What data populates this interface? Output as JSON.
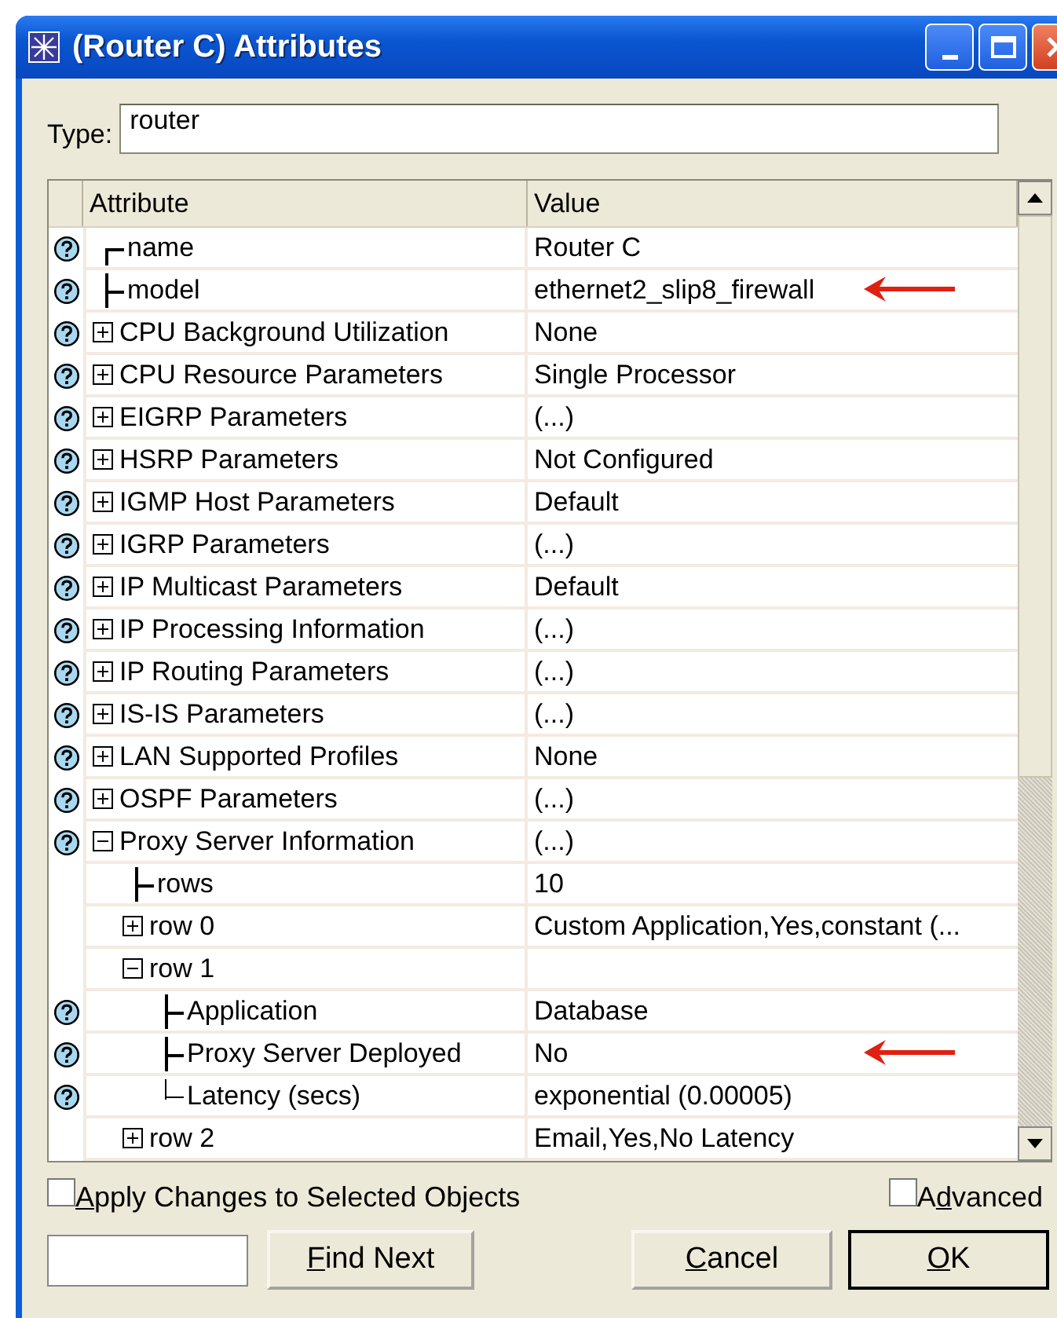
{
  "window": {
    "title": "(Router C) Attributes"
  },
  "type_field": {
    "label": "Type:",
    "value": "router"
  },
  "table": {
    "columns": [
      "Attribute",
      "Value"
    ],
    "rows": [
      {
        "name": "name",
        "value": "Router C",
        "help": true,
        "arrow": false
      },
      {
        "name": "model",
        "value": "ethernet2_slip8_firewall",
        "help": true,
        "arrow": true
      },
      {
        "name": "CPU Background Utilization",
        "value": "None",
        "help": true,
        "arrow": false,
        "expanded": false
      },
      {
        "name": "CPU Resource Parameters",
        "value": "Single Processor",
        "help": true,
        "arrow": false,
        "expanded": false
      },
      {
        "name": "EIGRP Parameters",
        "value": "(...)",
        "help": true,
        "arrow": false,
        "expanded": false
      },
      {
        "name": "HSRP Parameters",
        "value": "Not Configured",
        "help": true,
        "arrow": false,
        "expanded": false
      },
      {
        "name": "IGMP Host Parameters",
        "value": "Default",
        "help": true,
        "arrow": false,
        "expanded": false
      },
      {
        "name": "IGRP Parameters",
        "value": "(...)",
        "help": true,
        "arrow": false,
        "expanded": false
      },
      {
        "name": "IP Multicast Parameters",
        "value": "Default",
        "help": true,
        "arrow": false,
        "expanded": false
      },
      {
        "name": "IP Processing Information",
        "value": "(...)",
        "help": true,
        "arrow": false,
        "expanded": false
      },
      {
        "name": "IP Routing Parameters",
        "value": "(...)",
        "help": true,
        "arrow": false,
        "expanded": false
      },
      {
        "name": "IS-IS Parameters",
        "value": "(...)",
        "help": true,
        "arrow": false,
        "expanded": false
      },
      {
        "name": "LAN Supported Profiles",
        "value": "None",
        "help": true,
        "arrow": false,
        "expanded": false
      },
      {
        "name": "OSPF Parameters",
        "value": "(...)",
        "help": true,
        "arrow": false,
        "expanded": false
      },
      {
        "name": "Proxy Server Information",
        "value": "(...)",
        "help": true,
        "arrow": false,
        "expanded": true,
        "children": [
          {
            "name": "rows",
            "value": "10",
            "help": false,
            "arrow": false
          },
          {
            "name": "row 0",
            "value": "Custom Application,Yes,constant (...",
            "help": false,
            "arrow": false,
            "expanded": false
          },
          {
            "name": "row 1",
            "help": false,
            "arrow": false,
            "expanded": true,
            "children": [
              {
                "name": "Application",
                "value": "Database",
                "help": true,
                "arrow": false
              },
              {
                "name": "Proxy Server Deployed",
                "value": "No",
                "help": true,
                "arrow": true
              },
              {
                "name": "Latency (secs)",
                "value": "exponential (0.00005)",
                "help": true,
                "arrow": false
              }
            ]
          },
          {
            "name": "row 2",
            "value": "Email,Yes,No Latency",
            "help": false,
            "arrow": false,
            "expanded": false
          }
        ]
      }
    ]
  },
  "apply_changes": {
    "key": "A",
    "post": "pply Changes to Selected Objects",
    "checked": false
  },
  "advanced": {
    "pre": "A",
    "key": "d",
    "post": "vanced",
    "checked": false
  },
  "buttons": [
    {
      "key": "F",
      "post": "ind Next",
      "default": false
    },
    {
      "key": "C",
      "post": "ancel",
      "default": false
    },
    {
      "key": "O",
      "post": "K",
      "default": true
    }
  ]
}
